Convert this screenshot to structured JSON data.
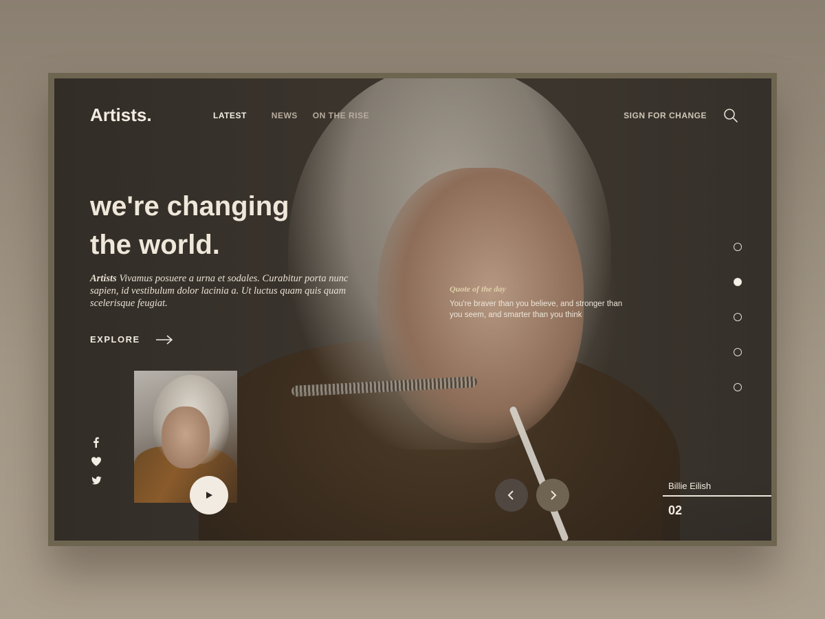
{
  "brand": {
    "logo": "Artists."
  },
  "nav": {
    "items": [
      {
        "label": "LATEST",
        "active": true
      },
      {
        "label": "NEWS"
      },
      {
        "label": "ON THE RISE"
      }
    ]
  },
  "header": {
    "cta": "SIGN FOR CHANGE",
    "search_icon": "search-icon"
  },
  "hero": {
    "headline_line1": "we're changing",
    "headline_line2": "the world.",
    "desc_lead": "Artists",
    "desc_body": " Vivamus posuere a urna et sodales. Curabitur porta nunc sapien, id vestibulum dolor lacinia a. Ut luctus quam quis quam scelerisque feugiat.",
    "explore_label": "EXPLORE"
  },
  "quote": {
    "title": "Quote of the day",
    "text": "You're braver than you believe, and stronger than you seem, and smarter than you think"
  },
  "pagination": {
    "count": 5,
    "active_index": 1
  },
  "social": [
    "facebook-icon",
    "heart-icon",
    "twitter-icon"
  ],
  "artist": {
    "name": "Billie Eilish",
    "number": "02"
  },
  "colors": {
    "background": "#332e28",
    "accent": "#6f6352",
    "text": "#efe7da"
  }
}
